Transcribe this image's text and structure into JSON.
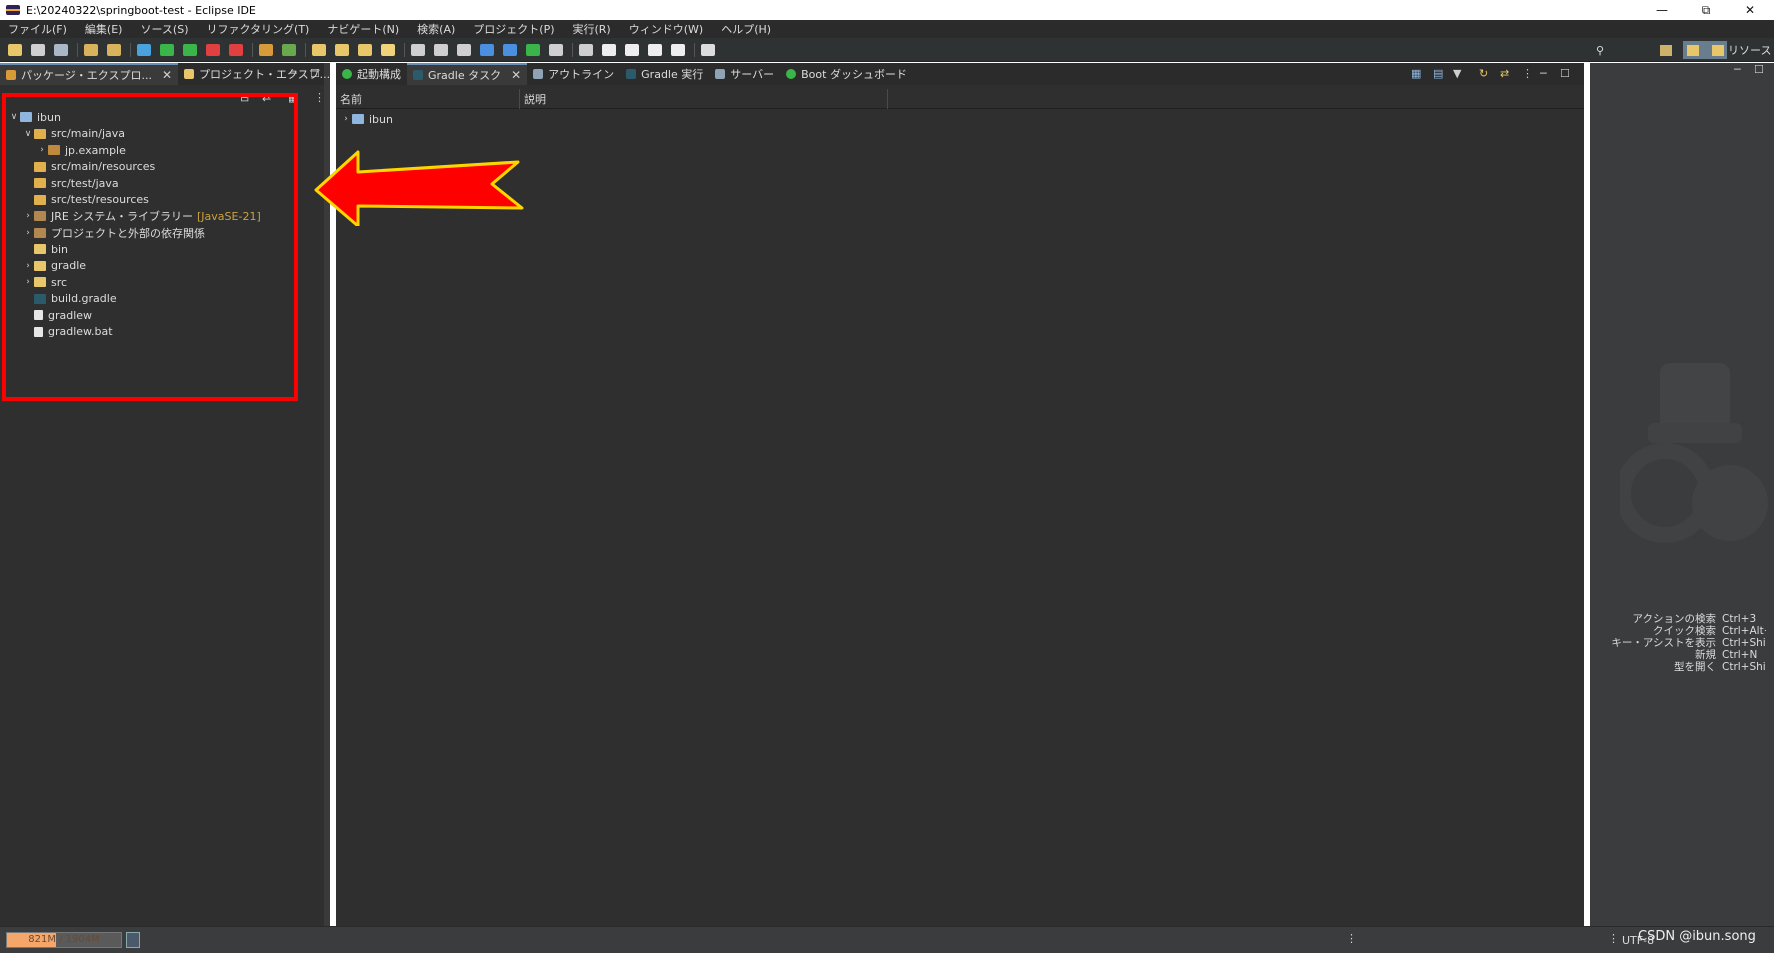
{
  "window": {
    "title": "E:\\20240322\\springboot-test - Eclipse IDE"
  },
  "menu": [
    "ファイル(F)",
    "編集(E)",
    "ソース(S)",
    "リファクタリング(T)",
    "ナビゲート(N)",
    "検索(A)",
    "プロジェクト(P)",
    "実行(R)",
    "ウィンドウ(W)",
    "ヘルプ(H)"
  ],
  "perspective": {
    "resource_label": "リソース"
  },
  "left_tabs": [
    {
      "label": "パッケージ・エクスプロ...",
      "active": true
    },
    {
      "label": "プロジェクト・エクスプ...",
      "active": false
    }
  ],
  "tree": [
    {
      "label": "ibun",
      "depth": 0,
      "twisty": "expanded",
      "icon": "project-icon"
    },
    {
      "label": "src/main/java",
      "depth": 1,
      "twisty": "expanded",
      "icon": "source-folder-icon"
    },
    {
      "label": "jp.example",
      "depth": 2,
      "twisty": "collapsed",
      "icon": "package-icon"
    },
    {
      "label": "src/main/resources",
      "depth": 1,
      "twisty": "",
      "icon": "source-folder-icon"
    },
    {
      "label": "src/test/java",
      "depth": 1,
      "twisty": "",
      "icon": "source-folder-icon"
    },
    {
      "label": "src/test/resources",
      "depth": 1,
      "twisty": "",
      "icon": "source-folder-icon"
    },
    {
      "label": "JRE システム・ライブラリー",
      "decor": "[JavaSE-21]",
      "depth": 1,
      "twisty": "collapsed",
      "icon": "library-icon"
    },
    {
      "label": "プロジェクトと外部の依存関係",
      "depth": 1,
      "twisty": "collapsed",
      "icon": "library-icon"
    },
    {
      "label": "bin",
      "depth": 1,
      "twisty": "",
      "icon": "folder-icon"
    },
    {
      "label": "gradle",
      "depth": 1,
      "twisty": "collapsed",
      "icon": "folder-icon"
    },
    {
      "label": "src",
      "depth": 1,
      "twisty": "collapsed",
      "icon": "folder-icon"
    },
    {
      "label": "build.gradle",
      "depth": 1,
      "twisty": "",
      "icon": "gradle-file-icon"
    },
    {
      "label": "gradlew",
      "depth": 1,
      "twisty": "",
      "icon": "file-icon"
    },
    {
      "label": "gradlew.bat",
      "depth": 1,
      "twisty": "",
      "icon": "file-icon"
    }
  ],
  "mid_tabs": [
    {
      "label": "起動構成",
      "active": false,
      "closable": false
    },
    {
      "label": "Gradle タスク",
      "active": true,
      "closable": true
    },
    {
      "label": "アウトライン",
      "active": false,
      "closable": false
    },
    {
      "label": "Gradle 実行",
      "active": false,
      "closable": false
    },
    {
      "label": "サーバー",
      "active": false,
      "closable": false
    },
    {
      "label": "Boot ダッシュボード",
      "active": false,
      "closable": false
    }
  ],
  "gradle_tasks": {
    "columns": [
      "名前",
      "説明"
    ],
    "rows": [
      {
        "label": "ibun",
        "twisty": "collapsed"
      }
    ]
  },
  "shortcuts": [
    {
      "label": "アクションの検索",
      "key": "Ctrl+3"
    },
    {
      "label": "クイック検索",
      "key": "Ctrl+Alt+"
    },
    {
      "label": "キー・アシストを表示",
      "key": "Ctrl+Shift"
    },
    {
      "label": "新規",
      "key": "Ctrl+N"
    },
    {
      "label": "型を開く",
      "key": "Ctrl+Shift"
    }
  ],
  "status": {
    "heap": "821M / 1904M",
    "heap_fraction": 0.43,
    "encoding": "UTF-8",
    "watermark": "CSDN @ibun.song"
  },
  "colors": {
    "annotation": "#ff0000",
    "heap_fill": "#f5a66b",
    "accent": "#6b8fb5"
  }
}
